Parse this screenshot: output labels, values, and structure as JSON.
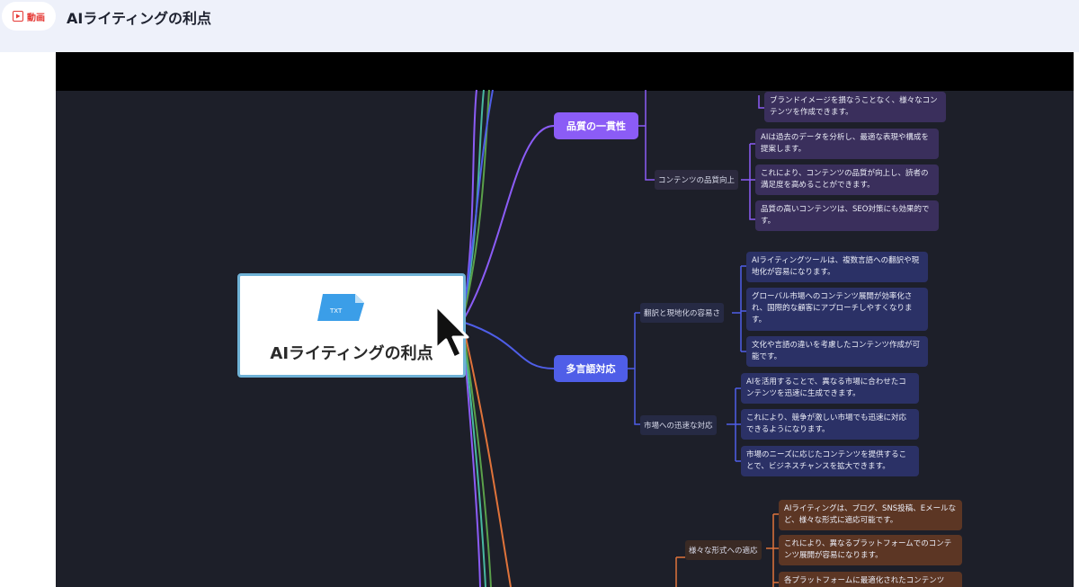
{
  "header": {
    "badge_label": "動画",
    "badge_icon": "play-icon",
    "title": "AIライティングの利点"
  },
  "mindmap": {
    "central": {
      "file_icon_text": "TXT",
      "title": "AIライティングの利点"
    },
    "branches": {
      "quality": {
        "label": "品質の一貫性",
        "color": "#8b5cf6",
        "top_leaf": "ブランドイメージを損なうことなく、様々なコンテンツを作成できます。",
        "sub": {
          "label": "コンテンツの品質向上",
          "leaves": [
            "AIは過去のデータを分析し、最適な表現や構成を提案します。",
            "これにより、コンテンツの品質が向上し、読者の満足度を高めることができます。",
            "品質の高いコンテンツは、SEO対策にも効果的です。"
          ]
        }
      },
      "multilingual": {
        "label": "多言語対応",
        "color": "#4f5ee8",
        "subs": [
          {
            "label": "翻訳と現地化の容易さ",
            "leaves": [
              "AIライティングツールは、複数言語への翻訳や現地化が容易になります。",
              "グローバル市場へのコンテンツ展開が効率化され、国際的な顧客にアプローチしやすくなります。",
              "文化や言語の違いを考慮したコンテンツ作成が可能です。"
            ]
          },
          {
            "label": "市場への迅速な対応",
            "leaves": [
              "AIを活用することで、異なる市場に合わせたコンテンツを迅速に生成できます。",
              "これにより、競争が激しい市場でも迅速に対応できるようになります。",
              "市場のニーズに応じたコンテンツを提供することで、ビジネスチャンスを拡大できます。"
            ]
          }
        ]
      },
      "formats": {
        "color": "#e0733a",
        "sub": {
          "label": "様々な形式への適応",
          "leaves": [
            "AIライティングは、ブログ、SNS投稿、Eメールなど、様々な形式に適応可能です。",
            "これにより、異なるプラットフォームでのコンテンツ展開が容易になります。",
            "各プラットフォームに最適化されたコンテンツ"
          ]
        }
      }
    }
  }
}
